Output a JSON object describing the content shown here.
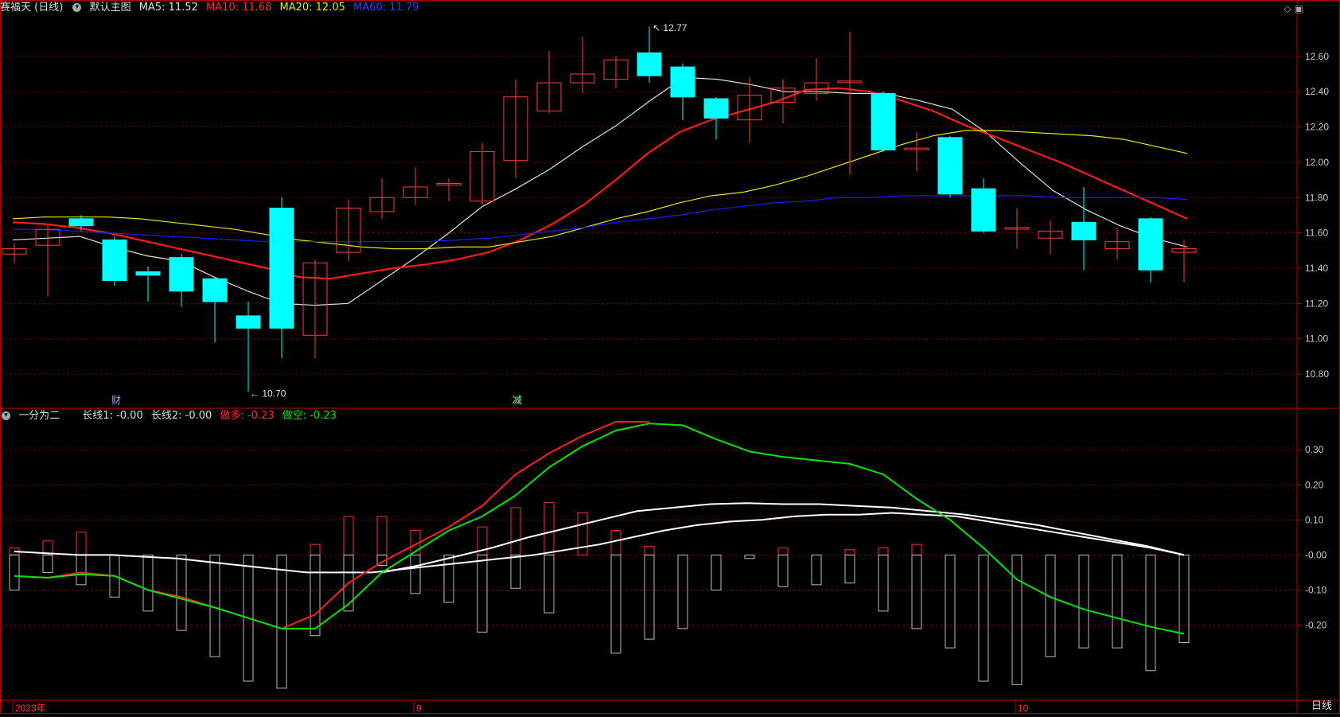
{
  "header": {
    "name": "赛福天 (日线)",
    "main_label": "默认主图",
    "ma5_label": "MA5: 11.52",
    "ma10_label": "MA10: 11.68",
    "ma20_label": "MA20: 12.05",
    "ma60_label": "MA60: 11.79"
  },
  "sub_header": {
    "name": "一分为二",
    "l1": "长线1: -0.00",
    "l2": "长线2: -0.00",
    "dd": "做多: -0.23",
    "dk": "做空: -0.23"
  },
  "colors": {
    "up": "#ff3c3c",
    "down": "#00ffff",
    "ma5": "#e0e0e0",
    "ma10": "#ff1a1a",
    "ma20": "#e6e600",
    "ma60": "#1a1aff",
    "bull": "#ff2020",
    "bear": "#00e600",
    "grid": "#5a0000",
    "axis": "#b40000"
  },
  "markers": {
    "high": "12.77",
    "low": "10.70",
    "mark1": "财",
    "mark2": "减"
  },
  "time_axis": [
    "2023年",
    "9",
    "10"
  ],
  "period_tab": "日线",
  "chart_data": [
    {
      "type": "candlestick",
      "title": "赛福天 (日线)",
      "ylim": [
        10.62,
        12.82
      ],
      "yticks": [
        10.8,
        11.0,
        11.2,
        11.4,
        11.6,
        11.8,
        12.0,
        12.2,
        12.4,
        12.6
      ],
      "ytick_labels": [
        "10.80",
        "11.00",
        "11.20",
        "11.40",
        "11.60",
        "11.80",
        "12.00",
        "12.20",
        "12.40",
        "12.60"
      ],
      "candles": [
        {
          "o": 11.48,
          "c": 11.51,
          "h": 11.54,
          "l": 11.43
        },
        {
          "o": 11.53,
          "c": 11.62,
          "h": 11.64,
          "l": 11.24
        },
        {
          "o": 11.68,
          "c": 11.64,
          "h": 11.7,
          "l": 11.61
        },
        {
          "o": 11.56,
          "c": 11.33,
          "h": 11.58,
          "l": 11.3
        },
        {
          "o": 11.38,
          "c": 11.36,
          "h": 11.41,
          "l": 11.21
        },
        {
          "o": 11.46,
          "c": 11.27,
          "h": 11.48,
          "l": 11.18
        },
        {
          "o": 11.34,
          "c": 11.21,
          "h": 11.35,
          "l": 10.98
        },
        {
          "o": 11.13,
          "c": 11.06,
          "h": 11.21,
          "l": 10.7
        },
        {
          "o": 11.74,
          "c": 11.06,
          "h": 11.8,
          "l": 10.89
        },
        {
          "o": 11.02,
          "c": 11.43,
          "h": 11.45,
          "l": 10.89
        },
        {
          "o": 11.49,
          "c": 11.74,
          "h": 11.79,
          "l": 11.44
        },
        {
          "o": 11.72,
          "c": 11.8,
          "h": 11.91,
          "l": 11.68
        },
        {
          "o": 11.8,
          "c": 11.86,
          "h": 11.97,
          "l": 11.76
        },
        {
          "o": 11.88,
          "c": 11.88,
          "h": 11.91,
          "l": 11.78
        },
        {
          "o": 11.78,
          "c": 12.06,
          "h": 12.11,
          "l": 11.76
        },
        {
          "o": 12.01,
          "c": 12.37,
          "h": 12.47,
          "l": 11.91
        },
        {
          "o": 12.29,
          "c": 12.45,
          "h": 12.63,
          "l": 12.28
        },
        {
          "o": 12.45,
          "c": 12.5,
          "h": 12.71,
          "l": 12.39
        },
        {
          "o": 12.47,
          "c": 12.58,
          "h": 12.6,
          "l": 12.42
        },
        {
          "o": 12.62,
          "c": 12.49,
          "h": 12.77,
          "l": 12.45
        },
        {
          "o": 12.54,
          "c": 12.37,
          "h": 12.56,
          "l": 12.24
        },
        {
          "o": 12.36,
          "c": 12.25,
          "h": 12.37,
          "l": 12.13
        },
        {
          "o": 12.24,
          "c": 12.38,
          "h": 12.48,
          "l": 12.11
        },
        {
          "o": 12.34,
          "c": 12.42,
          "h": 12.47,
          "l": 12.22
        },
        {
          "o": 12.39,
          "c": 12.45,
          "h": 12.59,
          "l": 12.35
        },
        {
          "o": 12.46,
          "c": 12.46,
          "h": 12.74,
          "l": 11.93
        },
        {
          "o": 12.39,
          "c": 12.07,
          "h": 12.4,
          "l": 12.06
        },
        {
          "o": 12.08,
          "c": 12.08,
          "h": 12.17,
          "l": 11.95
        },
        {
          "o": 12.14,
          "c": 11.82,
          "h": 12.15,
          "l": 11.8
        },
        {
          "o": 11.85,
          "c": 11.61,
          "h": 11.91,
          "l": 11.6
        },
        {
          "o": 11.63,
          "c": 11.63,
          "h": 11.74,
          "l": 11.51
        },
        {
          "o": 11.57,
          "c": 11.61,
          "h": 11.67,
          "l": 11.48
        },
        {
          "o": 11.66,
          "c": 11.56,
          "h": 11.86,
          "l": 11.39
        },
        {
          "o": 11.51,
          "c": 11.55,
          "h": 11.63,
          "l": 11.45
        },
        {
          "o": 11.68,
          "c": 11.39,
          "h": 11.69,
          "l": 11.32
        },
        {
          "o": 11.49,
          "c": 11.51,
          "h": 11.56,
          "l": 11.32
        }
      ],
      "series": [
        {
          "name": "MA5",
          "values": [
            11.56,
            11.57,
            11.58,
            11.52,
            11.47,
            11.44,
            11.35,
            11.27,
            11.2,
            11.19,
            11.2,
            11.33,
            11.46,
            11.6,
            11.75,
            11.85,
            11.96,
            12.09,
            12.21,
            12.35,
            12.48,
            12.47,
            12.44,
            12.4,
            12.4,
            12.39,
            12.39,
            12.35,
            12.3,
            12.17,
            12.0,
            11.84,
            11.73,
            11.64,
            11.57,
            11.52
          ]
        },
        {
          "name": "MA10",
          "values": [
            11.66,
            11.65,
            11.63,
            11.6,
            11.56,
            11.52,
            11.48,
            11.44,
            11.4,
            11.35,
            11.34,
            11.37,
            11.4,
            11.42,
            11.45,
            11.49,
            11.56,
            11.65,
            11.76,
            11.9,
            12.05,
            12.17,
            12.24,
            12.29,
            12.34,
            12.41,
            12.42,
            12.4,
            12.35,
            12.29,
            12.21,
            12.14,
            12.07,
            12.0,
            11.92,
            11.84,
            11.76,
            11.68
          ]
        },
        {
          "name": "MA20",
          "values": [
            11.68,
            11.69,
            11.69,
            11.69,
            11.68,
            11.66,
            11.64,
            11.62,
            11.59,
            11.56,
            11.54,
            11.52,
            11.51,
            11.51,
            11.52,
            11.52,
            11.55,
            11.58,
            11.63,
            11.68,
            11.72,
            11.77,
            11.81,
            11.83,
            11.87,
            11.92,
            11.98,
            12.04,
            12.1,
            12.15,
            12.18,
            12.18,
            12.17,
            12.16,
            12.15,
            12.13,
            12.09,
            12.05
          ]
        },
        {
          "name": "MA60",
          "values": [
            11.62,
            11.62,
            11.61,
            11.6,
            11.59,
            11.58,
            11.57,
            11.56,
            11.55,
            11.55,
            11.55,
            11.55,
            11.55,
            11.55,
            11.56,
            11.57,
            11.59,
            11.61,
            11.63,
            11.66,
            11.68,
            11.7,
            11.73,
            11.75,
            11.77,
            11.78,
            11.8,
            11.8,
            11.81,
            11.81,
            11.81,
            11.81,
            11.81,
            11.8,
            11.8,
            11.8,
            11.8,
            11.79
          ]
        }
      ]
    },
    {
      "type": "indicator",
      "title": "一分为二",
      "ylim": [
        -0.41,
        0.38
      ],
      "yticks": [
        0.3,
        0.2,
        0.1,
        0.0,
        -0.1,
        -0.2
      ],
      "ytick_labels": [
        "0.30",
        "0.20",
        "0.10",
        "-0.00",
        "-0.10",
        "-0.20"
      ],
      "bars_pos": [
        0.02,
        0.04,
        0.065,
        0.0,
        0.0,
        0.0,
        0.0,
        0.0,
        0.0,
        0.03,
        0.11,
        0.11,
        0.07,
        0.0,
        0.08,
        0.135,
        0.15,
        0.12,
        0.07,
        0.025,
        0.0,
        0.0,
        0.0,
        0.02,
        0.0,
        0.015,
        0.02,
        0.03,
        0.0,
        0.0,
        0.0,
        0.0,
        0.0,
        0.0,
        0.0,
        0.0,
        0.0
      ],
      "bars_neg": [
        -0.1,
        -0.05,
        -0.085,
        -0.12,
        -0.16,
        -0.215,
        -0.29,
        -0.36,
        -0.38,
        -0.23,
        -0.16,
        -0.03,
        -0.11,
        -0.135,
        -0.22,
        -0.095,
        -0.165,
        0.0,
        -0.28,
        -0.24,
        -0.21,
        -0.1,
        -0.01,
        -0.09,
        -0.085,
        -0.08,
        -0.16,
        -0.21,
        -0.265,
        -0.36,
        -0.37,
        -0.29,
        -0.265,
        -0.265,
        -0.33,
        -0.25
      ],
      "series": [
        {
          "name": "长线1",
          "values": [
            0.01,
            0.005,
            0.0,
            0.0,
            -0.005,
            -0.01,
            -0.02,
            -0.03,
            -0.04,
            -0.05,
            -0.05,
            -0.05,
            -0.04,
            -0.03,
            -0.02,
            -0.01,
            0.0,
            0.015,
            0.03,
            0.05,
            0.07,
            0.085,
            0.095,
            0.1,
            0.11,
            0.115,
            0.115,
            0.12,
            0.115,
            0.11,
            0.095,
            0.08,
            0.065,
            0.05,
            0.035,
            0.02,
            0.0
          ]
        },
        {
          "name": "长线2",
          "values": [
            -0.05,
            -0.03,
            -0.005,
            0.02,
            0.05,
            0.075,
            0.1,
            0.125,
            0.135,
            0.145,
            0.148,
            0.145,
            0.145,
            0.14,
            0.135,
            0.125,
            0.115,
            0.1,
            0.085,
            0.065,
            0.045,
            0.025,
            0.0
          ]
        },
        {
          "name": "做多",
          "values": [
            -0.06,
            -0.065,
            -0.05,
            -0.06,
            -0.1,
            -0.12,
            -0.15,
            -0.18,
            -0.21,
            -0.17,
            -0.08,
            -0.02,
            0.03,
            0.08,
            0.14,
            0.23,
            0.29,
            0.34,
            0.38,
            0.38
          ]
        },
        {
          "name": "做空",
          "values": [
            -0.06,
            -0.065,
            -0.055,
            -0.06,
            -0.1,
            -0.125,
            -0.15,
            -0.18,
            -0.21,
            -0.21,
            -0.14,
            -0.05,
            0.01,
            0.07,
            0.11,
            0.17,
            0.25,
            0.31,
            0.355,
            0.375,
            0.37,
            0.33,
            0.295,
            0.28,
            0.27,
            0.26,
            0.23,
            0.16,
            0.1,
            0.02,
            -0.07,
            -0.12,
            -0.155,
            -0.18,
            -0.205,
            -0.225
          ]
        }
      ]
    }
  ]
}
